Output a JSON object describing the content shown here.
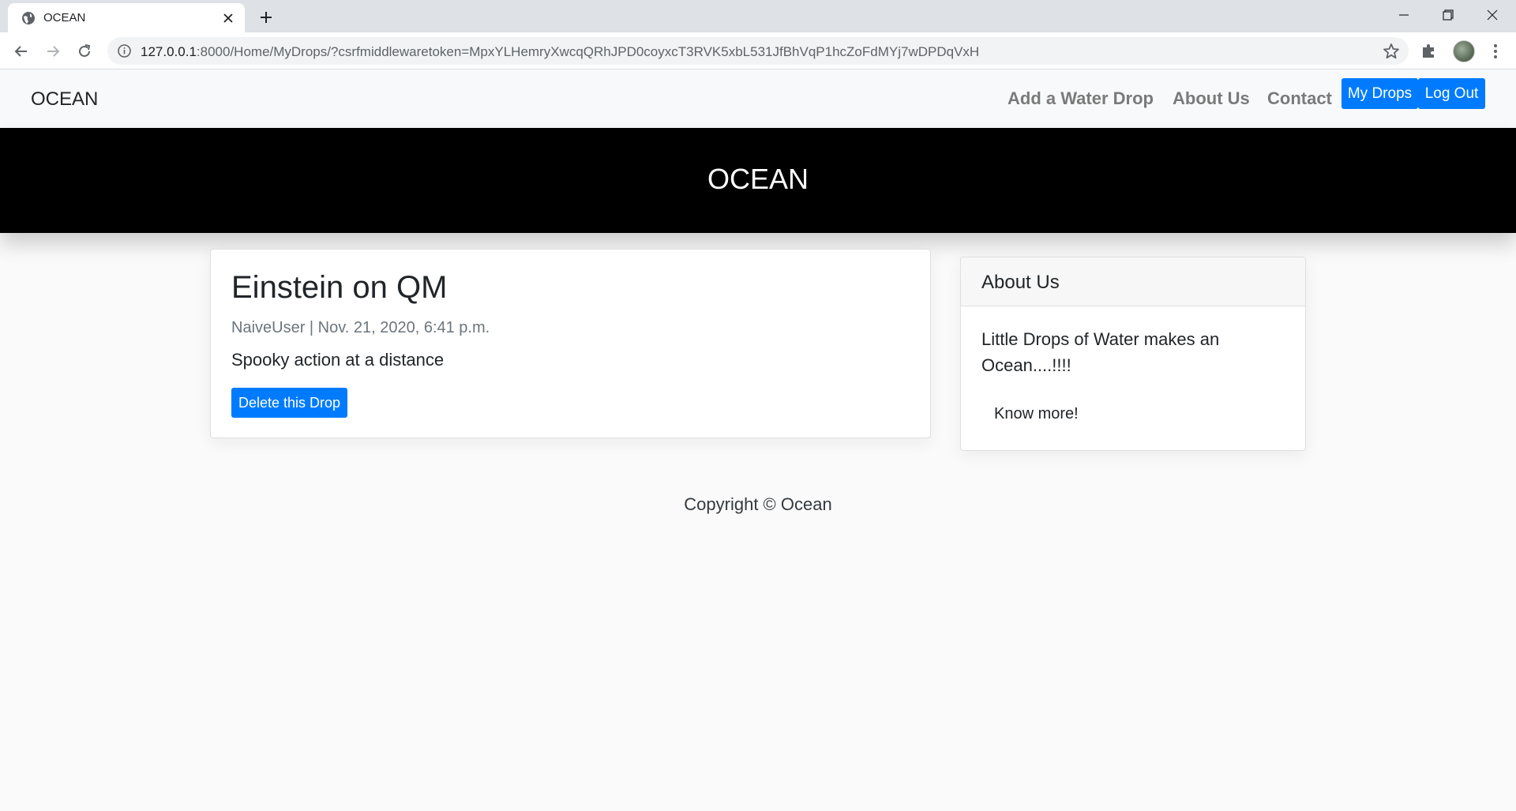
{
  "browser": {
    "tab_title": "OCEAN",
    "url_host": "127.0.0.1",
    "url_rest": ":8000/Home/MyDrops/?csrfmiddlewaretoken=MpxYLHemryXwcqQRhJPD0coyxcT3RVK5xbL531JfBhVqP1hcZoFdMYj7wDPDqVxH"
  },
  "nav": {
    "brand": "OCEAN",
    "links": [
      "Add a Water Drop",
      "About Us",
      "Contact"
    ],
    "my_drops": "My Drops",
    "log_out": "Log Out"
  },
  "masthead": {
    "title": "OCEAN"
  },
  "post": {
    "title": "Einstein on QM",
    "meta": "NaiveUser | Nov. 21, 2020, 6:41 p.m.",
    "body": "Spooky action at a distance",
    "delete_label": "Delete this Drop"
  },
  "about": {
    "title": "About Us",
    "text": "Little Drops of Water makes an Ocean....!!!!",
    "link": "Know more!"
  },
  "footer": {
    "text": "Copyright © Ocean"
  },
  "colors": {
    "primary": "#007bff",
    "masthead": "#000000",
    "navbar": "#f8f9fa"
  }
}
